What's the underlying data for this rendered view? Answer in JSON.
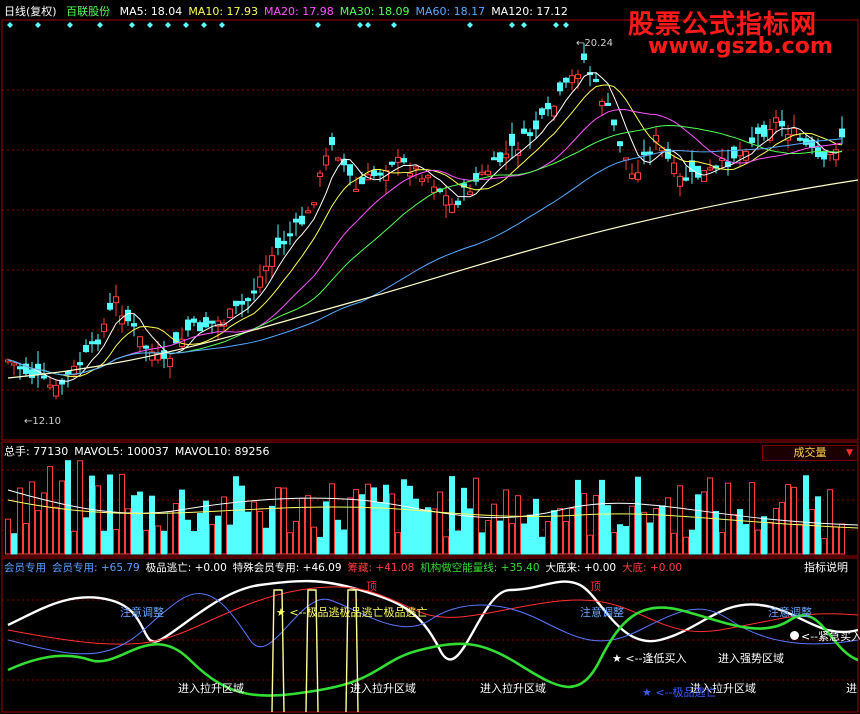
{
  "header": {
    "period": "日线(复权)",
    "stock_name": "百联股份",
    "ma": [
      {
        "label": "MA5: 18.04",
        "color": "#ffffff"
      },
      {
        "label": "MA10: 17.93",
        "color": "#ffff55"
      },
      {
        "label": "MA20: 17.98",
        "color": "#ff55ff"
      },
      {
        "label": "MA30: 18.09",
        "color": "#55ff55"
      },
      {
        "label": "MA60: 18.17",
        "color": "#55aaff"
      },
      {
        "label": "MA120: 17.12",
        "color": "#ffffff"
      }
    ]
  },
  "watermark": {
    "line1": "股票公式指标网",
    "line2": "www.gszb.com"
  },
  "price": {
    "high_label": "20.24",
    "low_label": "12.10"
  },
  "volume": {
    "labels": [
      {
        "text": "总手: 77130",
        "color": "#ffffff"
      },
      {
        "text": "MAVOL5: 100037",
        "color": "#ffffff"
      },
      {
        "text": "MAVOL10: 89256",
        "color": "#ffffff"
      }
    ],
    "button": "成交量"
  },
  "indicator": {
    "labels": [
      {
        "text": "会员专用",
        "color": "#5aa0ff"
      },
      {
        "text": "会员专用: +65.79",
        "color": "#5aa0ff"
      },
      {
        "text": "极品逃亡: +0.00",
        "color": "#ffffff"
      },
      {
        "text": "特殊会员专用: +46.09",
        "color": "#ffffff"
      },
      {
        "text": "筹藏: +41.08",
        "color": "#ff4040"
      },
      {
        "text": "机构做空能量线: +35.40",
        "color": "#33dd33"
      },
      {
        "text": "大底来: +0.00",
        "color": "#ffffff"
      },
      {
        "text": "大底: +0.00",
        "color": "#ff4040"
      }
    ],
    "button": "指标说明",
    "signals": {
      "top": "顶",
      "caution": "注意调整",
      "escape": "★ <--极品逃极品逃亡极品逃亡",
      "low_buy": "★ <--逢低买入",
      "enter_strong": "进入强势区域",
      "urgent_buy": "<--紧急买入",
      "enter_lift": "进入拉升区域",
      "bottom_sign": "★ <--极品逃亡",
      "enter_short": "进"
    }
  },
  "colors": {
    "up": "#ff3c3c",
    "down": "#54ffff",
    "grid": "#8b0000",
    "frame": "#a00000"
  }
}
